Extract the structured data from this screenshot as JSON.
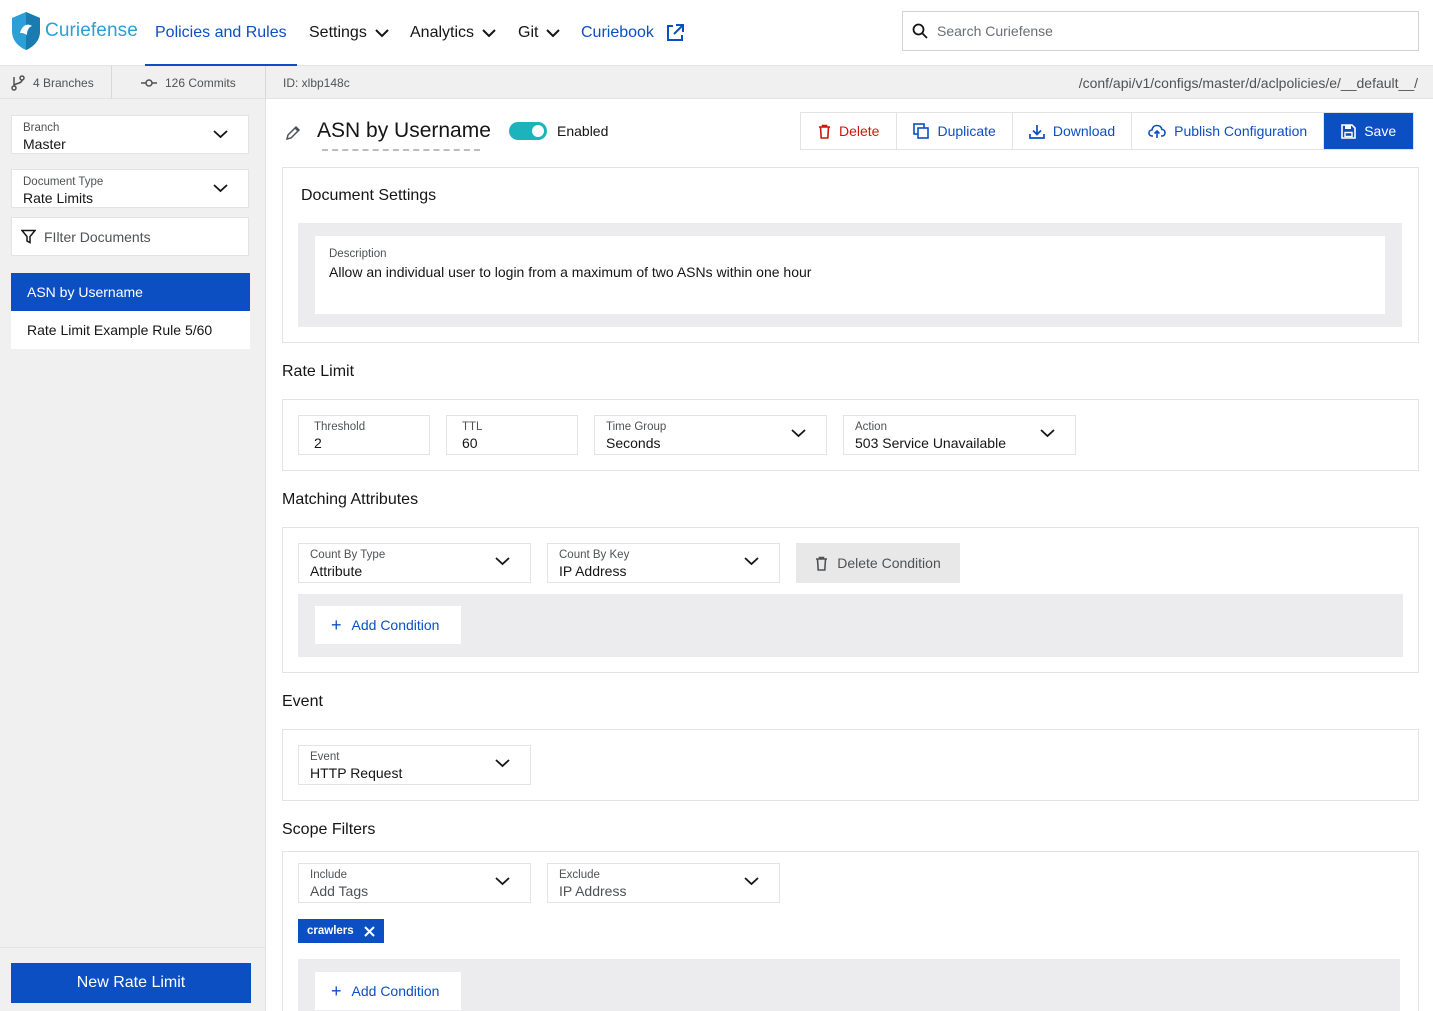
{
  "header": {
    "logo_text": "Curiefense",
    "nav": {
      "policies": "Policies and Rules",
      "settings": "Settings",
      "analytics": "Analytics",
      "git": "Git",
      "curiebook": "Curiebook"
    },
    "search_placeholder": "Search Curiefense"
  },
  "subbar": {
    "branches": "4 Branches",
    "commits": "126 Commits",
    "doc_id": "ID: xlbp148c",
    "path": "/conf/api/v1/configs/master/d/aclpolicies/e/__default__/"
  },
  "sidebar": {
    "branch_label": "Branch",
    "branch_value": "Master",
    "doctype_label": "Document Type",
    "doctype_value": "Rate Limits",
    "filter_placeholder": "FIlter Documents",
    "documents": [
      "ASN by Username",
      "Rate Limit Example Rule 5/60"
    ],
    "new_button": "New Rate Limit"
  },
  "editor": {
    "title": "ASN by Username",
    "enabled_label": "Enabled",
    "enabled": true,
    "actions": {
      "delete": "Delete",
      "duplicate": "Duplicate",
      "download": "Download",
      "publish": "Publish Configuration",
      "save": "Save"
    },
    "document_settings": {
      "title": "Document Settings",
      "description_label": "Description",
      "description_value": "Allow an individual user to login from a maximum of two ASNs within one hour"
    },
    "rate_limit": {
      "title": "Rate Limit",
      "threshold_label": "Threshold",
      "threshold_value": "2",
      "ttl_label": "TTL",
      "ttl_value": "60",
      "time_group_label": "Time Group",
      "time_group_value": "Seconds",
      "action_label": "Action",
      "action_value": "503 Service Unavailable"
    },
    "matching": {
      "title": "Matching Attributes",
      "count_by_type_label": "Count By Type",
      "count_by_type_value": "Attribute",
      "count_by_key_label": "Count By Key",
      "count_by_key_value": "IP Address",
      "delete_condition": "Delete Condition",
      "add_condition": "Add Condition"
    },
    "event": {
      "title": "Event",
      "label": "Event",
      "value": "HTTP Request"
    },
    "scope": {
      "title": "Scope Filters",
      "include_label": "Include",
      "include_placeholder": "Add Tags",
      "exclude_label": "Exclude",
      "exclude_placeholder": "IP Address",
      "tags": [
        "crawlers"
      ],
      "add_condition": "Add Condition"
    }
  },
  "colors": {
    "primary": "#0b4fc2",
    "danger": "#c9190b",
    "toggle": "#1bb4bd",
    "logo": "#2b9fd6"
  }
}
